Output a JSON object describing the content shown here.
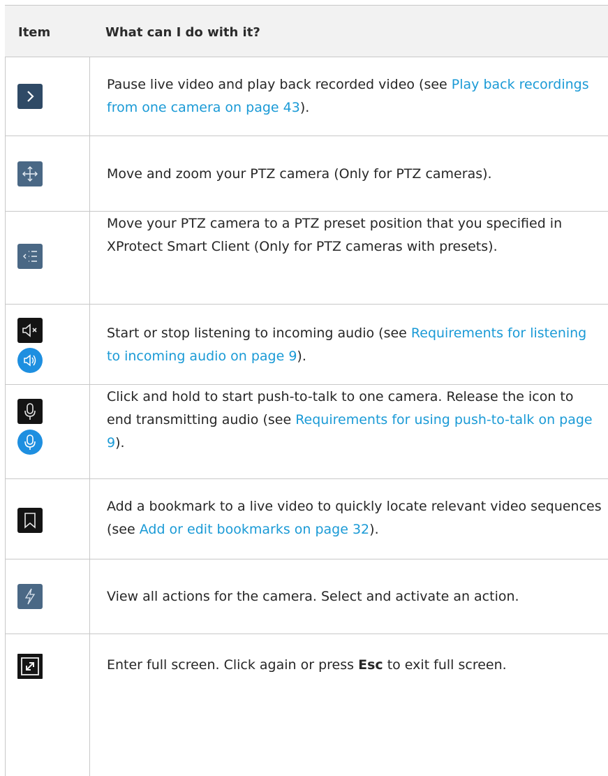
{
  "header": {
    "item": "Item",
    "what": "What can I do with it?"
  },
  "rows": [
    {
      "icon": "playback-chevron-icon",
      "text_a": "Pause live video and play back recorded video (see ",
      "link": "Play back recordings from one camera on page 43",
      "text_b": ")."
    },
    {
      "icon": "ptz-move-arrows-icon",
      "text_a": "Move and zoom your PTZ camera (Only for PTZ cameras).",
      "link": "",
      "text_b": ""
    },
    {
      "icon": "ptz-presets-list-icon",
      "text_a": "Move your PTZ camera to a PTZ preset position that you specified in XProtect Smart Client (Only for PTZ cameras with presets).",
      "link": "",
      "text_b": ""
    },
    {
      "icon": "speaker-muted-icon",
      "icon2": "speaker-active-icon",
      "text_a": "Start or stop listening to incoming audio (see ",
      "link": "Requirements for listening to incoming audio on page 9",
      "text_b": ")."
    },
    {
      "icon": "microphone-icon",
      "icon2": "microphone-active-icon",
      "text_a": "Click and hold to start push-to-talk to one camera. Release the icon to end transmitting audio (see ",
      "link": "Requirements for using push-to-talk on page 9",
      "text_b": ")."
    },
    {
      "icon": "bookmark-icon",
      "text_a": "Add a bookmark to a live video to quickly locate relevant video sequences (see ",
      "link": "Add or edit bookmarks on page 32",
      "text_b": ")."
    },
    {
      "icon": "lightning-actions-icon",
      "text_a": "View all actions for the camera. Select and activate an action.",
      "link": "",
      "text_b": ""
    },
    {
      "icon": "fullscreen-icon",
      "text_a": "Enter full screen. Click again or press ",
      "bold": "Esc",
      "text_b": " to exit full screen."
    }
  ],
  "colors": {
    "link": "#1a9ad6",
    "header_bg": "#f2f2f2",
    "border": "#c8c8c8",
    "active_blue": "#1e8fe0"
  }
}
